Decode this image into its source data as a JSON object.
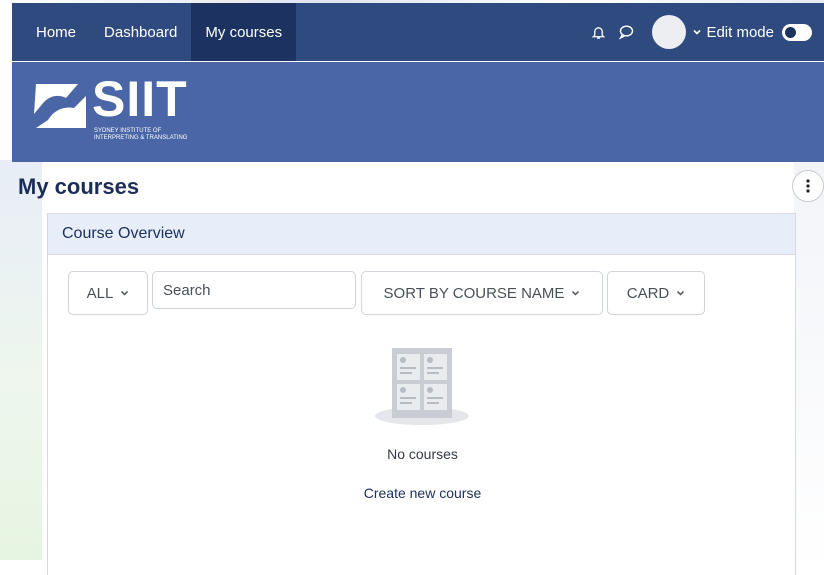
{
  "navbar": {
    "items": [
      {
        "label": "Home"
      },
      {
        "label": "Dashboard"
      },
      {
        "label": "My courses",
        "active": true
      }
    ],
    "edit_mode_label": "Edit mode",
    "icons": [
      "bell-icon",
      "message-icon",
      "chevron-down-icon"
    ],
    "background": "#2e4a7f",
    "active_background": "#1c3260"
  },
  "banner": {
    "logo_text": "SIIT",
    "logo_subtitle_line1": "SYDNEY INSTITUTE OF",
    "logo_subtitle_line2": "INTERPRETING & TRANSLATING",
    "background": "#4a66a7"
  },
  "page": {
    "title": "My courses"
  },
  "course_overview": {
    "header": "Course Overview",
    "filter_label": "ALL",
    "search_placeholder": "Search",
    "sort_label": "SORT BY COURSE NAME",
    "view_label": "CARD",
    "empty_text": "No courses",
    "create_link": "Create new course"
  }
}
